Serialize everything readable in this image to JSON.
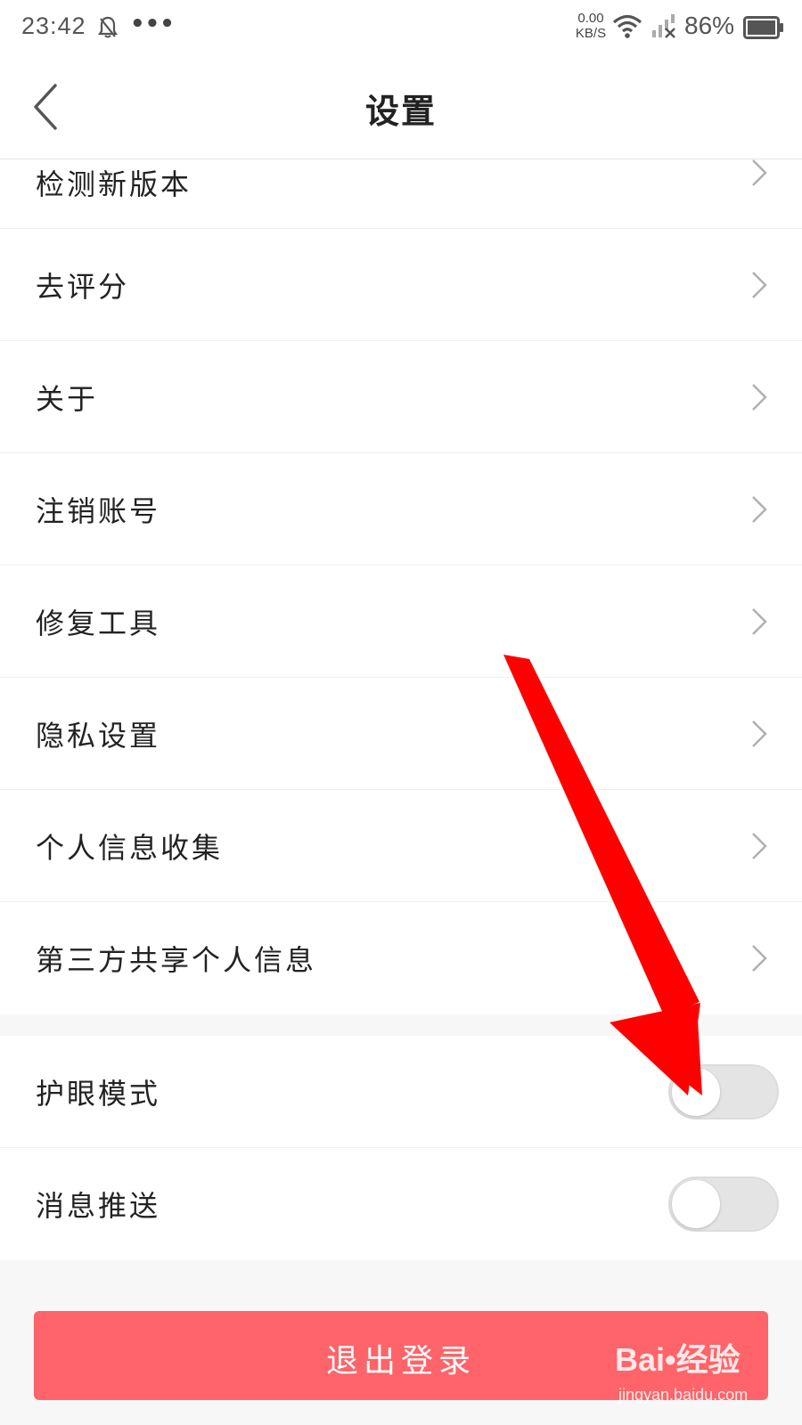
{
  "status_bar": {
    "time": "23:42",
    "speed_value": "0.00",
    "speed_unit": "KB/S",
    "battery": "86%",
    "icons": [
      "bell-muted-icon",
      "more-dots-icon",
      "wifi-icon",
      "signal-off-icon",
      "battery-icon"
    ]
  },
  "header": {
    "title": "设置",
    "back_icon": "chevron-left-icon"
  },
  "menu_items": [
    {
      "label": "检测新版本"
    },
    {
      "label": "去评分"
    },
    {
      "label": "关于"
    },
    {
      "label": "注销账号"
    },
    {
      "label": "修复工具"
    },
    {
      "label": "隐私设置"
    },
    {
      "label": "个人信息收集"
    },
    {
      "label": "第三方共享个人信息"
    }
  ],
  "toggles": [
    {
      "label": "护眼模式",
      "on": false
    },
    {
      "label": "消息推送",
      "on": false
    }
  ],
  "logout_label": "退出登录",
  "watermark": {
    "brand": "Bai•经验",
    "url": "jingyan.baidu.com"
  },
  "colors": {
    "accent": "#fe6469",
    "arrow": "#ff0000",
    "toggle_off": "#e4e4e4"
  }
}
